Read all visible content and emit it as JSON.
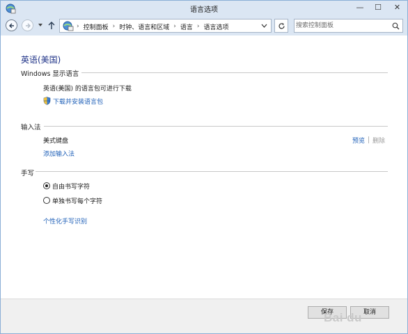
{
  "window": {
    "title": "语言选项",
    "controls": {
      "minimize": "—",
      "maximize": "☐",
      "close": "✕"
    }
  },
  "toolbar": {
    "breadcrumbs": [
      "控制面板",
      "时钟、语言和区域",
      "语言",
      "语言选项"
    ],
    "separator": "›",
    "search_placeholder": "搜索控制面板"
  },
  "content": {
    "title": "英语(美国)",
    "display_language": {
      "heading": "Windows 显示语言",
      "status_text": "英语(美国) 的语言包可进行下载",
      "download_link": "下载并安装语言包"
    },
    "input_method": {
      "heading": "输入法",
      "keyboard_name": "美式键盘",
      "preview_link": "预览",
      "delete_link": "删除",
      "add_link": "添加输入法"
    },
    "handwriting": {
      "heading": "手写",
      "options": [
        {
          "label": "自由书写字符",
          "selected": true
        },
        {
          "label": "单独书写每个字符",
          "selected": false
        }
      ],
      "personalize_link": "个性化手写识别"
    }
  },
  "footer": {
    "ok_label": "保存",
    "cancel_label": "取消",
    "watermark": "Bai du"
  },
  "colors": {
    "accent_title": "#1e3287",
    "link": "#1f60b8",
    "chrome": "#dbe6f3"
  }
}
